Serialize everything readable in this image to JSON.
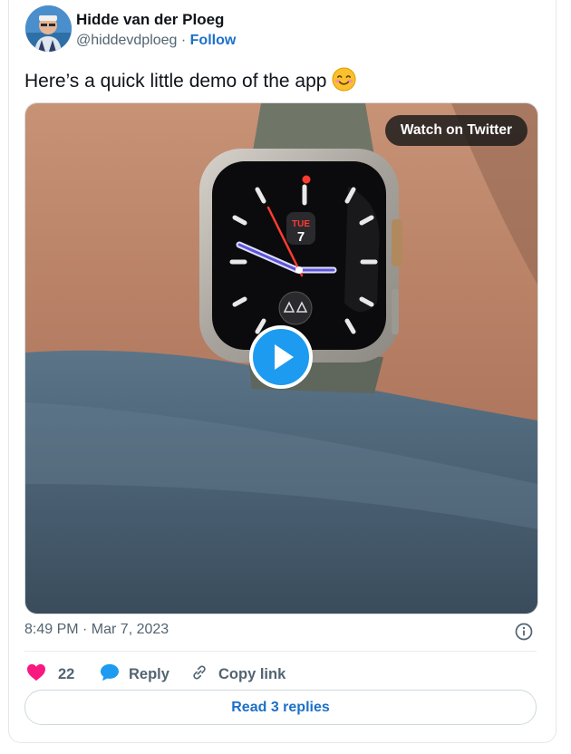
{
  "author": {
    "name": "Hidde van der Ploeg",
    "handle": "@hiddevdploeg",
    "separator": " · ",
    "follow_label": "Follow",
    "avatar_icon": "user-avatar"
  },
  "tweet": {
    "text": "Here’s a quick little demo of the app",
    "emoji": "smiling-face-emoji"
  },
  "media": {
    "watch_label": "Watch on Twitter",
    "play_icon": "play-icon",
    "watch_face": {
      "day": "TUE",
      "date": "7"
    }
  },
  "meta": {
    "timestamp": "8:49 PM · Mar 7, 2023",
    "info_icon": "info-icon"
  },
  "actions": {
    "likes": "22",
    "reply_label": "Reply",
    "copy_label": "Copy link"
  },
  "read_replies_label": "Read 3 replies",
  "colors": {
    "accent": "#1d9bf0",
    "link": "#1d70c9",
    "like": "#f91880",
    "text_secondary": "#536471"
  }
}
